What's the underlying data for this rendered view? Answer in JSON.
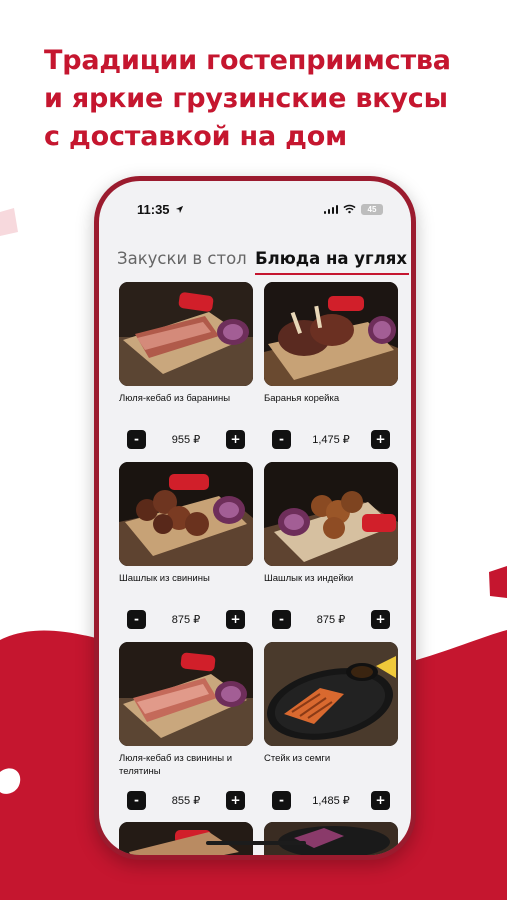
{
  "headline": {
    "line1": "Традиции гостеприимства",
    "line2": "и яркие грузинские вкусы",
    "line3": "с доставкой на дом"
  },
  "colors": {
    "brand_red": "#c5162f",
    "phone_frame": "#9b1b2e",
    "screen_bg": "#f2f2f4",
    "button_dark": "#111111"
  },
  "status_bar": {
    "time": "11:35",
    "location_icon": "location-arrow-icon",
    "signal_icon": "cellular-signal-icon",
    "wifi_icon": "wifi-icon",
    "battery_level": "45"
  },
  "tabs": [
    {
      "label": "Закуски в стол",
      "active": false
    },
    {
      "label": "Блюда на углях",
      "active": true
    }
  ],
  "products": [
    {
      "name": "Люля-кебаб из баранины",
      "price": "955 ₽",
      "minus": "-",
      "plus": "+",
      "photo": "lula-kebab-lamb-photo"
    },
    {
      "name": "Баранья корейка",
      "price": "1,475 ₽",
      "minus": "-",
      "plus": "+",
      "photo": "lamb-rack-photo"
    },
    {
      "name": "Шашлык из свинины",
      "price": "875 ₽",
      "minus": "-",
      "plus": "+",
      "photo": "pork-shashlik-photo"
    },
    {
      "name": "Шашлык из индейки",
      "price": "875 ₽",
      "minus": "-",
      "plus": "+",
      "photo": "turkey-shashlik-photo"
    },
    {
      "name": "Люля-кебаб из свинины и телятины",
      "price": "855 ₽",
      "minus": "-",
      "plus": "+",
      "photo": "lula-kebab-pork-veal-photo"
    },
    {
      "name": "Стейк из семги",
      "price": "1,485 ₽",
      "minus": "-",
      "plus": "+",
      "photo": "salmon-steak-photo"
    }
  ]
}
